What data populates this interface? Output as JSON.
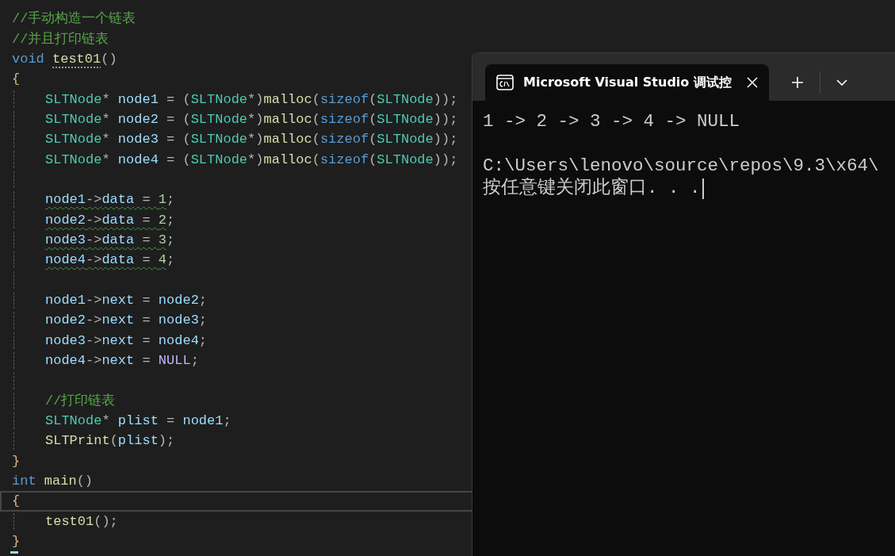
{
  "editor": {
    "lines": [
      {
        "guide": false,
        "current": false,
        "tokens": [
          {
            "kind": "comment",
            "s": "//手动构造一个链表"
          }
        ]
      },
      {
        "guide": false,
        "current": false,
        "tokens": [
          {
            "kind": "comment",
            "s": "//并且打印链表"
          }
        ]
      },
      {
        "guide": false,
        "current": false,
        "tokens": [
          {
            "kind": "keyword",
            "s": "void"
          },
          {
            "kind": "func",
            "s": "test01",
            "hint": true
          },
          {
            "kind": "punct",
            "s": "()"
          }
        ]
      },
      {
        "guide": false,
        "current": false,
        "tokens": [
          {
            "kind": "brace",
            "s": "{"
          }
        ]
      },
      {
        "guide": true,
        "current": false,
        "tokens": [
          {
            "kind": "type",
            "s": "SLTNode"
          },
          {
            "kind": "punct",
            "s": "* "
          },
          {
            "kind": "var",
            "s": "node1"
          },
          {
            "kind": "punct",
            "s": " = ("
          },
          {
            "kind": "type",
            "s": "SLTNode"
          },
          {
            "kind": "punct",
            "s": "*)"
          },
          {
            "kind": "func",
            "s": "malloc"
          },
          {
            "kind": "punct",
            "s": "("
          },
          {
            "kind": "keyword",
            "s": "sizeof"
          },
          {
            "kind": "punct",
            "s": "("
          },
          {
            "kind": "type",
            "s": "SLTNode"
          },
          {
            "kind": "punct",
            "s": "));"
          }
        ]
      },
      {
        "guide": true,
        "current": false,
        "tokens": [
          {
            "kind": "type",
            "s": "SLTNode"
          },
          {
            "kind": "punct",
            "s": "* "
          },
          {
            "kind": "var",
            "s": "node2"
          },
          {
            "kind": "punct",
            "s": " = ("
          },
          {
            "kind": "type",
            "s": "SLTNode"
          },
          {
            "kind": "punct",
            "s": "*)"
          },
          {
            "kind": "func",
            "s": "malloc"
          },
          {
            "kind": "punct",
            "s": "("
          },
          {
            "kind": "keyword",
            "s": "sizeof"
          },
          {
            "kind": "punct",
            "s": "("
          },
          {
            "kind": "type",
            "s": "SLTNode"
          },
          {
            "kind": "punct",
            "s": "));"
          }
        ]
      },
      {
        "guide": true,
        "current": false,
        "tokens": [
          {
            "kind": "type",
            "s": "SLTNode"
          },
          {
            "kind": "punct",
            "s": "* "
          },
          {
            "kind": "var",
            "s": "node3"
          },
          {
            "kind": "punct",
            "s": " = ("
          },
          {
            "kind": "type",
            "s": "SLTNode"
          },
          {
            "kind": "punct",
            "s": "*)"
          },
          {
            "kind": "func",
            "s": "malloc"
          },
          {
            "kind": "punct",
            "s": "("
          },
          {
            "kind": "keyword",
            "s": "sizeof"
          },
          {
            "kind": "punct",
            "s": "("
          },
          {
            "kind": "type",
            "s": "SLTNode"
          },
          {
            "kind": "punct",
            "s": "));"
          }
        ]
      },
      {
        "guide": true,
        "current": false,
        "tokens": [
          {
            "kind": "type",
            "s": "SLTNode"
          },
          {
            "kind": "punct",
            "s": "* "
          },
          {
            "kind": "var",
            "s": "node4"
          },
          {
            "kind": "punct",
            "s": " = ("
          },
          {
            "kind": "type",
            "s": "SLTNode"
          },
          {
            "kind": "punct",
            "s": "*)"
          },
          {
            "kind": "func",
            "s": "malloc"
          },
          {
            "kind": "punct",
            "s": "("
          },
          {
            "kind": "keyword",
            "s": "sizeof"
          },
          {
            "kind": "punct",
            "s": "("
          },
          {
            "kind": "type",
            "s": "SLTNode"
          },
          {
            "kind": "punct",
            "s": "));"
          }
        ]
      },
      {
        "guide": true,
        "current": false
      },
      {
        "guide": true,
        "current": false,
        "tokens": [
          {
            "kind": "var",
            "s": "node1",
            "warn": true
          },
          {
            "kind": "punct",
            "s": "->",
            "warn": true
          },
          {
            "kind": "var",
            "s": "data",
            "warn": true
          },
          {
            "kind": "punct",
            "s": " = ",
            "warn": true
          },
          {
            "kind": "number",
            "s": "1",
            "warn": true
          },
          {
            "kind": "punct",
            "s": ";",
            "warn": false
          }
        ]
      },
      {
        "guide": true,
        "current": false,
        "tokens": [
          {
            "kind": "var",
            "s": "node2",
            "warn": true
          },
          {
            "kind": "punct",
            "s": "->",
            "warn": true
          },
          {
            "kind": "var",
            "s": "data",
            "warn": true
          },
          {
            "kind": "punct",
            "s": " = ",
            "warn": true
          },
          {
            "kind": "number",
            "s": "2",
            "warn": true
          },
          {
            "kind": "punct",
            "s": ";",
            "warn": false
          }
        ]
      },
      {
        "guide": true,
        "current": false,
        "tokens": [
          {
            "kind": "var",
            "s": "node3",
            "warn": true
          },
          {
            "kind": "punct",
            "s": "->",
            "warn": true
          },
          {
            "kind": "var",
            "s": "data",
            "warn": true
          },
          {
            "kind": "punct",
            "s": " = ",
            "warn": true
          },
          {
            "kind": "number",
            "s": "3",
            "warn": true
          },
          {
            "kind": "punct",
            "s": ";",
            "warn": false
          }
        ]
      },
      {
        "guide": true,
        "current": false,
        "tokens": [
          {
            "kind": "var",
            "s": "node4",
            "warn": true
          },
          {
            "kind": "punct",
            "s": "->",
            "warn": true
          },
          {
            "kind": "var",
            "s": "data",
            "warn": true
          },
          {
            "kind": "punct",
            "s": " = ",
            "warn": true
          },
          {
            "kind": "number",
            "s": "4",
            "warn": true
          },
          {
            "kind": "punct",
            "s": ";",
            "warn": false
          }
        ]
      },
      {
        "guide": true,
        "current": false
      },
      {
        "guide": true,
        "current": false,
        "tokens": [
          {
            "kind": "var",
            "s": "node1"
          },
          {
            "kind": "punct",
            "s": "->"
          },
          {
            "kind": "var",
            "s": "next"
          },
          {
            "kind": "punct",
            "s": " = "
          },
          {
            "kind": "var",
            "s": "node2"
          },
          {
            "kind": "punct",
            "s": ";"
          }
        ]
      },
      {
        "guide": true,
        "current": false,
        "tokens": [
          {
            "kind": "var",
            "s": "node2"
          },
          {
            "kind": "punct",
            "s": "->"
          },
          {
            "kind": "var",
            "s": "next"
          },
          {
            "kind": "punct",
            "s": " = "
          },
          {
            "kind": "var",
            "s": "node3"
          },
          {
            "kind": "punct",
            "s": ";"
          }
        ]
      },
      {
        "guide": true,
        "current": false,
        "tokens": [
          {
            "kind": "var",
            "s": "node3"
          },
          {
            "kind": "punct",
            "s": "->"
          },
          {
            "kind": "var",
            "s": "next"
          },
          {
            "kind": "punct",
            "s": " = "
          },
          {
            "kind": "var",
            "s": "node4"
          },
          {
            "kind": "punct",
            "s": ";"
          }
        ]
      },
      {
        "guide": true,
        "current": false,
        "tokens": [
          {
            "kind": "var",
            "s": "node4"
          },
          {
            "kind": "punct",
            "s": "->"
          },
          {
            "kind": "var",
            "s": "next"
          },
          {
            "kind": "punct",
            "s": " = "
          },
          {
            "kind": "macro",
            "s": "NULL"
          },
          {
            "kind": "punct",
            "s": ";"
          }
        ]
      },
      {
        "guide": true,
        "current": false
      },
      {
        "guide": true,
        "current": false,
        "tokens": [
          {
            "kind": "comment",
            "s": "//打印链表"
          }
        ]
      },
      {
        "guide": true,
        "current": false,
        "tokens": [
          {
            "kind": "type",
            "s": "SLTNode"
          },
          {
            "kind": "punct",
            "s": "* "
          },
          {
            "kind": "var",
            "s": "plist"
          },
          {
            "kind": "punct",
            "s": " = "
          },
          {
            "kind": "var",
            "s": "node1"
          },
          {
            "kind": "punct",
            "s": ";"
          }
        ]
      },
      {
        "guide": true,
        "current": false,
        "tokens": [
          {
            "kind": "func",
            "s": "SLTPrint"
          },
          {
            "kind": "punct",
            "s": "("
          },
          {
            "kind": "var",
            "s": "plist"
          },
          {
            "kind": "punct",
            "s": ");"
          }
        ]
      },
      {
        "guide": false,
        "current": false,
        "tokens": [
          {
            "kind": "brace",
            "s": "}"
          }
        ]
      },
      {
        "guide": false,
        "current": false,
        "tokens": [
          {
            "kind": "keyword",
            "s": "int"
          },
          {
            "kind": "func",
            "s": "main"
          },
          {
            "kind": "punct",
            "s": "()"
          }
        ]
      },
      {
        "guide": false,
        "current": true,
        "tokens": [
          {
            "kind": "brace",
            "s": "{"
          }
        ]
      },
      {
        "guide": true,
        "current": false,
        "tokens": [
          {
            "kind": "func",
            "s": "test01"
          },
          {
            "kind": "punct",
            "s": "();"
          }
        ]
      },
      {
        "guide": false,
        "current": false,
        "tokens": [
          {
            "kind": "brace",
            "s": "}"
          }
        ]
      }
    ]
  },
  "terminal": {
    "tab": {
      "title": "Microsoft Visual Studio 调试控",
      "selected": true
    },
    "output": [
      {
        "text": "1 -> 2 -> 3 -> 4 -> NULL",
        "blank_before": false
      },
      {
        "text": "C:\\Users\\lenovo\\source\\repos\\9.3\\x64\\",
        "blank_before": true
      },
      {
        "text": "按任意键关闭此窗口. . .",
        "blank_before": false
      }
    ]
  }
}
